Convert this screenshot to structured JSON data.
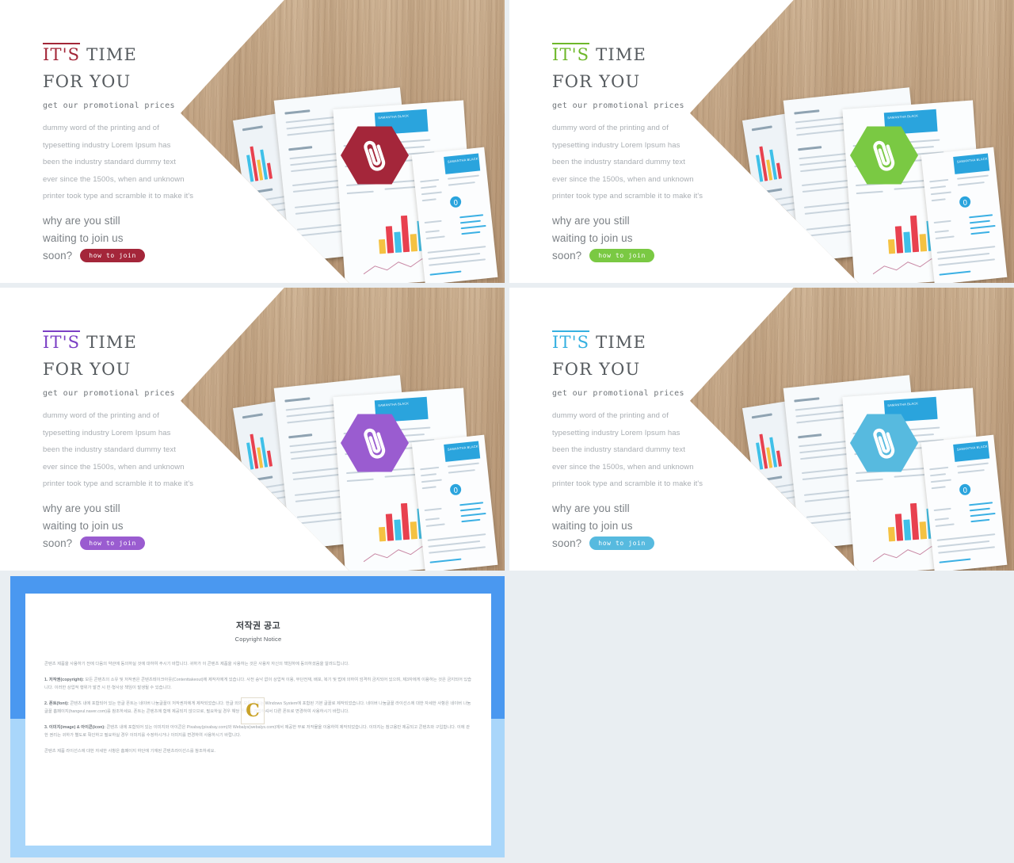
{
  "page": {
    "background": "#e9eef2",
    "slide_count": 4
  },
  "slides": [
    {
      "id": "slide-crimson",
      "accent": "#a32638",
      "hex_color": "#a4263a",
      "button_color": "#a4263a",
      "heading_accent": "IT'S",
      "heading_rest": " TIME",
      "heading_line2": "FOR YOU",
      "subheading": "get our promotional prices",
      "paragraph": [
        "dummy word of the printing and of",
        "typesetting industry Lorem Ipsum has",
        "been the industry standard dummy text",
        "ever since the 1500s, when and unknown",
        "printer took type and scramble it to make it's"
      ],
      "tagline": [
        "why are you still",
        "waiting to join us",
        "soon?"
      ],
      "cta_label": "how to join",
      "icon": "paperclip-icon"
    },
    {
      "id": "slide-green",
      "accent": "#6eb82a",
      "hex_color": "#7ac943",
      "button_color": "#7ac943",
      "heading_accent": "IT'S",
      "heading_rest": " TIME",
      "heading_line2": "FOR YOU",
      "subheading": "get our promotional prices",
      "paragraph": [
        "dummy word of the printing and of",
        "typesetting industry Lorem Ipsum has",
        "been the industry standard dummy text",
        "ever since the 1500s, when and unknown",
        "printer took type and scramble it to make it's"
      ],
      "tagline": [
        "why are you still",
        "waiting to join us",
        "soon?"
      ],
      "cta_label": "how to join",
      "icon": "paperclip-icon"
    },
    {
      "id": "slide-purple",
      "accent": "#7b3fc4",
      "hex_color": "#9a5cd0",
      "button_color": "#9a5cd0",
      "heading_accent": "IT'S",
      "heading_rest": " TIME",
      "heading_line2": "FOR YOU",
      "subheading": "get our promotional prices",
      "paragraph": [
        "dummy word of the printing and of",
        "typesetting industry Lorem Ipsum has",
        "been the industry standard dummy text",
        "ever since the 1500s, when and unknown",
        "printer took type and scramble it to make it's"
      ],
      "tagline": [
        "why are you still",
        "waiting to join us",
        "soon?"
      ],
      "cta_label": "how to join",
      "icon": "paperclip-icon"
    },
    {
      "id": "slide-blue",
      "accent": "#35b0e0",
      "hex_color": "#57badf",
      "button_color": "#57badf",
      "heading_accent": "IT'S",
      "heading_rest": " TIME",
      "heading_line2": "FOR YOU",
      "subheading": "get our promotional prices",
      "paragraph": [
        "dummy word of the printing and of",
        "typesetting industry Lorem Ipsum has",
        "been the industry standard dummy text",
        "ever since the 1500s, when and unknown",
        "printer took type and scramble it to make it's"
      ],
      "tagline": [
        "why are you still",
        "waiting to join us",
        "soon?"
      ],
      "cta_label": "how to join",
      "icon": "paperclip-icon"
    }
  ],
  "mockup": {
    "resume_name_line1": "SAMANTHA",
    "resume_name_line2": "BLACK",
    "resume_name_small": "SAMANTHA BLACK",
    "wood_color": "#c3a585",
    "chart_bar_colors": [
      "#e8414f",
      "#f5c242",
      "#3fc0e8",
      "#2aa4dd"
    ]
  },
  "notice": {
    "title": "저작권 공고",
    "subtitle": "Copyright Notice",
    "intro": "콘텐츠 제품을 사용하기 전에 다음의 약관에 동의하실 것에 대하여 주시기 바랍니다. 귀하가 이 콘텐츠 제품을 사용하는 것은 사용자 자신의 책임하에 동의하셨음을 알려드립니다.",
    "sections": [
      {
        "label": "1. 저작권(copyright):",
        "text": " 모든 콘텐츠의 소유 및 저작권은 콘텐츠테이크아웃(Contenttakeout)에 제작자에게 있습니다. 사전 승낙 없이 상업적 이용, 무단전재, 배포, 복기 및 법에 의하여 엄격히 금지되어 있으며, 제3자에게 이용하는 것은 금지되어 있습니다. 이러한 상업적 행위가 발견 시 민·형사상 책임이 발생될 수 있습니다."
      },
      {
        "label": "2. 폰트(font):",
        "text": " 콘텐츠 내에 포함되어 있는 한글 폰트는 네이버 나눔글꼴이 저작권자에게 제작되었습니다. 한글 외의 모든 폰트는 Windows System에 포함된 기본 글꼴로 제작되었습니다. 네이버 나눔글꼴 라이선스에 대한 자세한 사항은 네이버 나눔글꼴 홈페이지(hangeul.naver.com)를 참조하세요. 폰트는 콘텐츠에 함께 제공되지 않으므로, 필요하실 경우 해당 폰트를 가입하셔서 다른 폰트로 변경하여 사용하시기 바랍니다."
      },
      {
        "label": "3. 이미지(image) & 아이콘(icon):",
        "text": " 콘텐츠 내에 포함되어 있는 이미지와 아이콘은 Pixabay(pixabay.com)와 Webalys(webalys.com)에서 제공한 무료 저작물을 이용하여 제작되었습니다. 이미지는 참고용만 제공되고 콘텐츠와 구입합니다. 이에 관한 권리는 귀하가 별도로 확인하고 필요하실 경우 이미지를 수정하시거나 이미지를 변경하여 사용하시기 바랍니다."
      }
    ],
    "closing": "콘텐츠 제품 라이선스에 대한 자세한 사항은 홈페이지 하단에 기재된 콘텐츠라이선스를 참조하세요.",
    "watermark": "C",
    "frame_color_top": "#4a98f0",
    "frame_color_bottom": "#a9d6fa"
  }
}
